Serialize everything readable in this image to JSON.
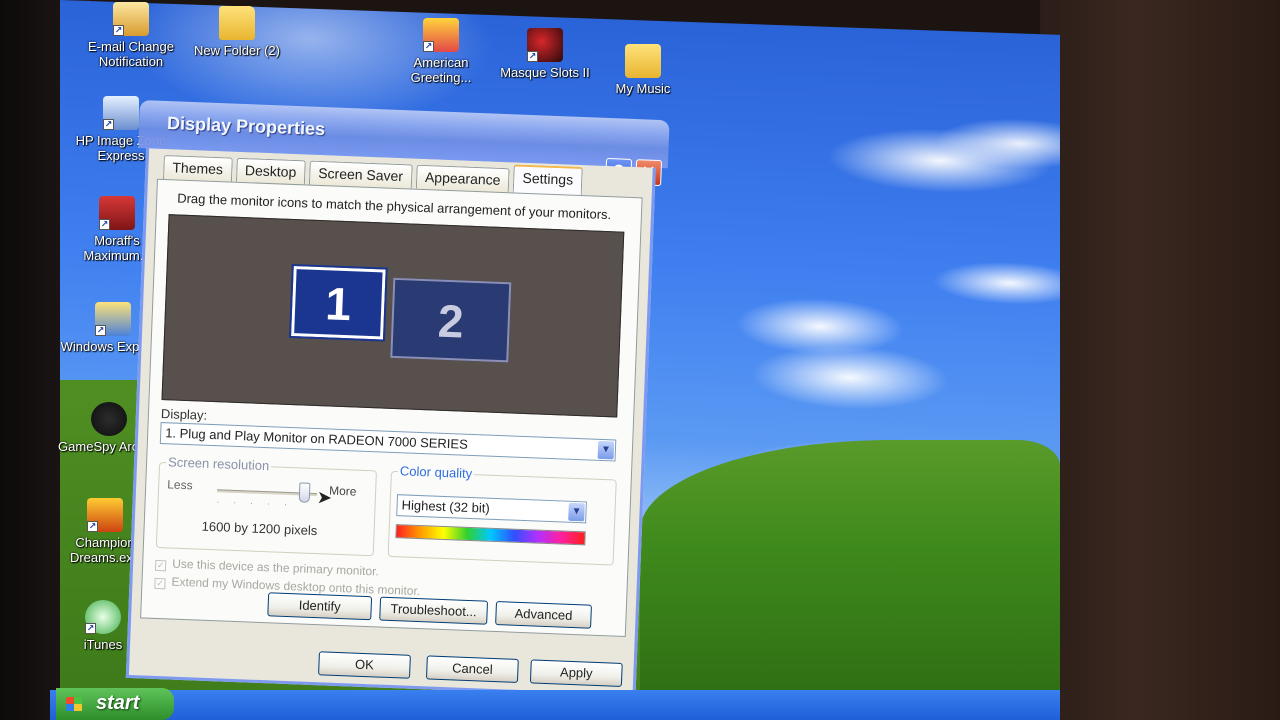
{
  "desktop_icons": [
    {
      "label": "E-mail Change Notification",
      "icon": "mail-icon"
    },
    {
      "label": "New Folder (2)",
      "icon": "folder-icon"
    },
    {
      "label": "American Greeting...",
      "icon": "greeting-card-icon"
    },
    {
      "label": "Masque Slots II",
      "icon": "slots-icon"
    },
    {
      "label": "My Music",
      "icon": "music-folder-icon"
    },
    {
      "label": "HP Image Zone Express",
      "icon": "image-zone-icon"
    },
    {
      "label": "Moraff's Maximum...",
      "icon": "moraff-icon"
    },
    {
      "label": "Windows Explorer",
      "icon": "explorer-icon"
    },
    {
      "label": "GameSpy Arcade",
      "icon": "gamespy-icon"
    },
    {
      "label": "Champion Dreams.exe",
      "icon": "champion-icon"
    },
    {
      "label": "iTunes",
      "icon": "itunes-icon"
    }
  ],
  "window": {
    "title": "Display Properties",
    "help_glyph": "?",
    "close_glyph": "✕",
    "tabs": [
      {
        "label": "Themes"
      },
      {
        "label": "Desktop"
      },
      {
        "label": "Screen Saver"
      },
      {
        "label": "Appearance"
      },
      {
        "label": "Settings"
      }
    ],
    "active_tab": "Settings",
    "hint": "Drag the monitor icons to match the physical arrangement of your monitors.",
    "monitors": [
      "1",
      "2"
    ],
    "display_label": "Display:",
    "display_value": "1. Plug and Play Monitor on RADEON 7000 SERIES",
    "resolution": {
      "title": "Screen resolution",
      "less": "Less",
      "more": "More",
      "value": "1600 by 1200 pixels"
    },
    "color_quality": {
      "title": "Color quality",
      "value": "Highest (32 bit)"
    },
    "checkboxes": [
      {
        "label": "Use this device as the primary monitor."
      },
      {
        "label": "Extend my Windows desktop onto this monitor."
      }
    ],
    "buttons": {
      "identify": "Identify",
      "troubleshoot": "Troubleshoot...",
      "advanced": "Advanced",
      "ok": "OK",
      "cancel": "Cancel",
      "apply": "Apply"
    }
  },
  "taskbar": {
    "start_label": "start"
  },
  "colors": {
    "title_bar": "#7d9af0",
    "active_tab_accent": "#f4b84a",
    "monitor_area": "#58504d",
    "monitor_primary": "#1b3690"
  }
}
